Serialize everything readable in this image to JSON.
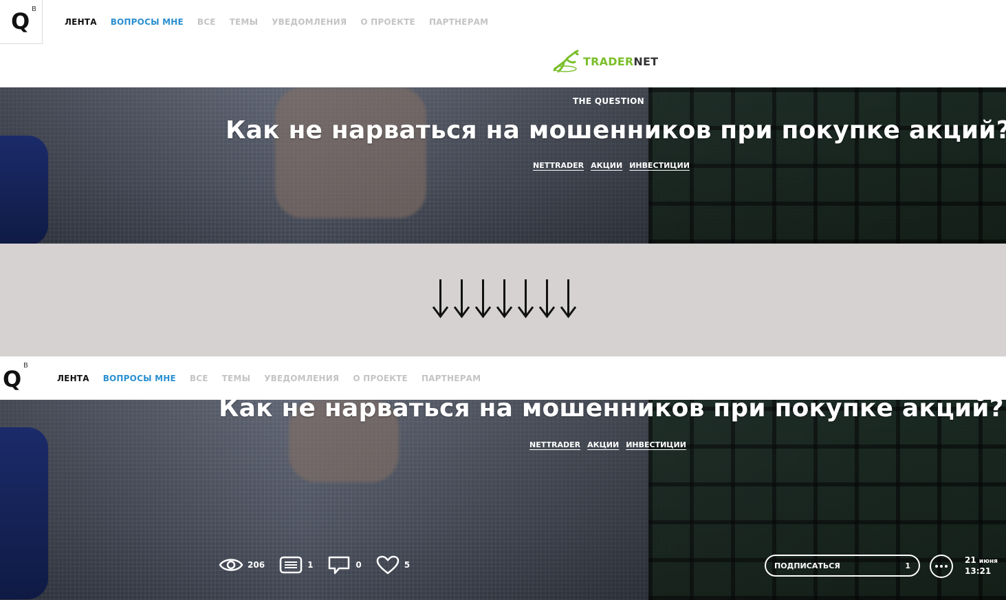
{
  "header": {
    "logo_letter": "Q",
    "logo_sup": "B",
    "nav": [
      {
        "label": "ЛЕНТА",
        "state": "active"
      },
      {
        "label": "ВОПРОСЫ МНЕ",
        "state": "highlight"
      },
      {
        "label": "ВСЕ",
        "state": "muted"
      },
      {
        "label": "ТЕМЫ",
        "state": "muted"
      },
      {
        "label": "УВЕДОМЛЕНИЯ",
        "state": "muted"
      },
      {
        "label": "О ПРОЕКТЕ",
        "state": "muted"
      },
      {
        "label": "ПАРТНЕРАМ",
        "state": "muted"
      }
    ],
    "partner": {
      "part1": "TRADER",
      "part2": "NET"
    }
  },
  "hero": {
    "eyebrow": "THE QUESTION",
    "title": "Как не нарваться на мошенников при покупке акций?",
    "tags": [
      "NETTRADER",
      "АКЦИИ",
      "ИНВЕСТИЦИИ"
    ]
  },
  "stats": {
    "views": "206",
    "answers": "1",
    "comments": "0",
    "likes": "5"
  },
  "subscribe": {
    "label": "ПОДПИСАТЬСЯ",
    "count": "1"
  },
  "date": {
    "day": "21",
    "month": "июня",
    "time": "13:21"
  },
  "colors": {
    "accent": "#2a8fd1",
    "partner_green": "#7bbf2a",
    "divider": "#d6d2d2"
  }
}
